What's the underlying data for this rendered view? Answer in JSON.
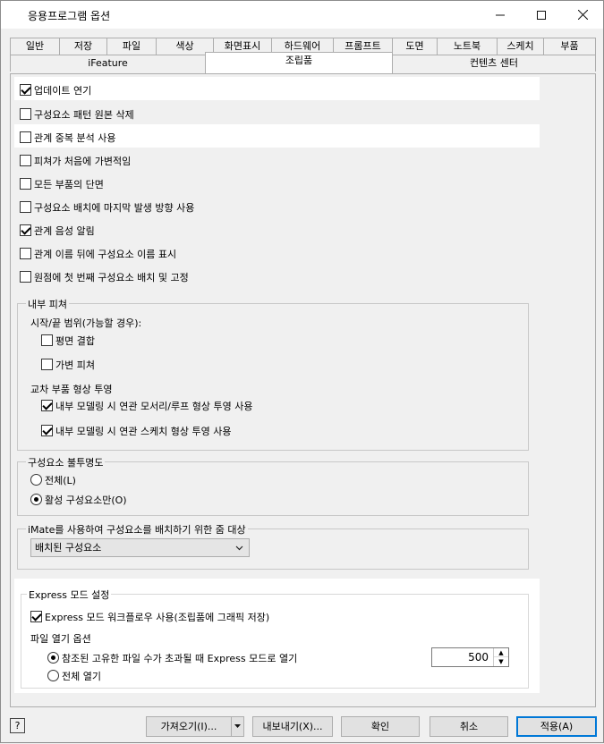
{
  "window": {
    "title": "응용프로그램 옵션",
    "minimize_icon": "minimize-icon",
    "maximize_icon": "maximize-icon",
    "close_icon": "close-icon"
  },
  "tabs_row1": [
    "일반",
    "저장",
    "파일",
    "색상",
    "화면표시",
    "하드웨어",
    "프롬프트",
    "도면",
    "노트북",
    "스케치",
    "부품"
  ],
  "tabs_row2": [
    "iFeature",
    "조립품",
    "컨텐츠 센터"
  ],
  "active_tab": "조립품",
  "options": [
    {
      "label": "업데이트 연기",
      "checked": true
    },
    {
      "label": "구성요소 패턴 원본 삭제",
      "checked": false
    },
    {
      "label": "관계 중복 분석 사용",
      "checked": false
    },
    {
      "label": "피쳐가 처음에 가변적임",
      "checked": false
    },
    {
      "label": "모든 부품의 단면",
      "checked": false
    },
    {
      "label": "구성요소 배치에 마지막 발생 방향 사용",
      "checked": false
    },
    {
      "label": "관계 음성 알림",
      "checked": true
    },
    {
      "label": "관계 이름 뒤에 구성요소 이름 표시",
      "checked": false
    },
    {
      "label": "원점에 첫 번째 구성요소 배치 및 고정",
      "checked": false
    }
  ],
  "internal_features": {
    "title": "내부 피쳐",
    "range_label": "시작/끝 범위(가능할 경우):",
    "range_options": [
      {
        "label": "평면 결합",
        "checked": false
      },
      {
        "label": "가변 피쳐",
        "checked": false
      }
    ],
    "projection_label": "교차 부품 형상 투영",
    "projection_options": [
      {
        "label": "내부 모델링 시 연관 모서리/루프 형상 투영 사용",
        "checked": true
      },
      {
        "label": "내부 모델링 시 연관 스케치 형상 투영 사용",
        "checked": true
      }
    ]
  },
  "opacity": {
    "title": "구성요소 불투명도",
    "all_label": "전체(L)",
    "active_label": "활성 구성요소만(O)",
    "selected": "active"
  },
  "imate": {
    "title": "iMate를 사용하여 구성요소를 배치하기 위한 줌 대상",
    "selected": "배치된 구성요소"
  },
  "express": {
    "title": "Express 모드 설정",
    "workflow_label": "Express 모드 워크플로우 사용(조립품에 그래픽 저장)",
    "workflow_checked": true,
    "open_options_label": "파일 열기 옵션",
    "threshold_label": "참조된 고유한 파일 수가 초과될 때 Express 모드로 열기",
    "threshold_value": "500",
    "all_open_label": "전체 열기",
    "selected": "threshold"
  },
  "footer": {
    "help_icon": "help-icon",
    "import_label": "가져오기(I)...",
    "export_label": "내보내기(X)...",
    "ok_label": "확인",
    "cancel_label": "취소",
    "apply_label": "적용(A)"
  }
}
